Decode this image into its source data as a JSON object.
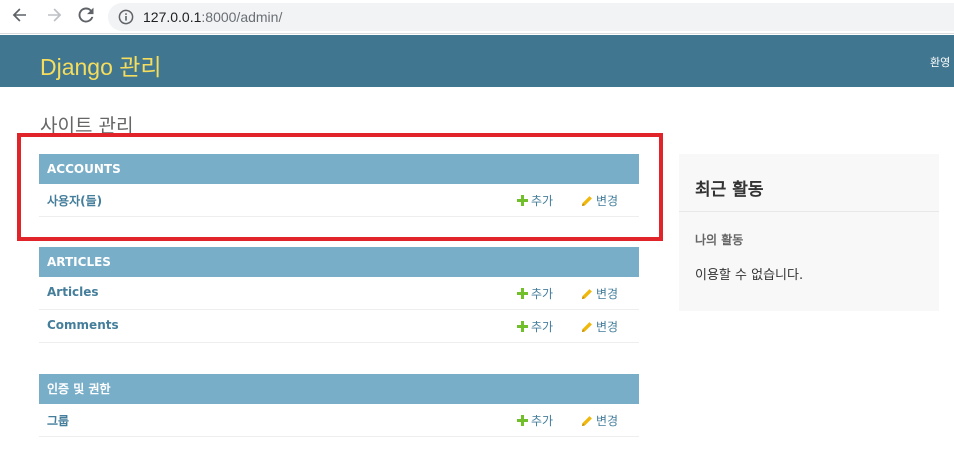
{
  "browser": {
    "url_host": "127.0.0.1",
    "url_rest": ":8000/admin/"
  },
  "header": {
    "branding": "Django 관리",
    "user_tools_partial": "환영"
  },
  "content": {
    "title": "사이트 관리"
  },
  "modules": [
    {
      "caption": "ACCOUNTS",
      "models": [
        {
          "name": "사용자(들)",
          "add_label": "추가",
          "change_label": "변경"
        }
      ]
    },
    {
      "caption": "ARTICLES",
      "models": [
        {
          "name": "Articles",
          "add_label": "추가",
          "change_label": "변경"
        },
        {
          "name": "Comments",
          "add_label": "추가",
          "change_label": "변경"
        }
      ]
    },
    {
      "caption": "인증 및 권한",
      "models": [
        {
          "name": "그룹",
          "add_label": "추가",
          "change_label": "변경"
        }
      ]
    }
  ],
  "recent_actions": {
    "title": "최근 활동",
    "my_actions_title": "나의 활동",
    "empty_text": "이용할 수 없습니다."
  },
  "colors": {
    "header_bg": "#417690",
    "branding": "#f5dd5d",
    "caption_bg": "#79aec8",
    "link": "#447e9b",
    "add_icon": "#70bf2b",
    "change_icon": "#efb80b",
    "highlight": "#e0242a"
  },
  "icons": {
    "back": "arrow-left-icon",
    "forward": "arrow-right-icon",
    "reload": "reload-icon",
    "site_info": "info-icon",
    "add": "plus-icon",
    "change": "pencil-icon"
  }
}
